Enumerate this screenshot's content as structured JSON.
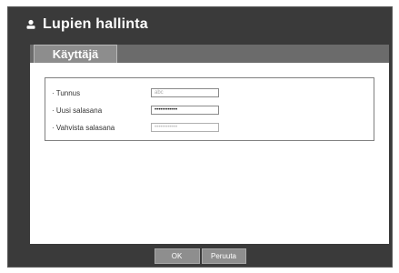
{
  "window": {
    "title": "Lupien hallinta",
    "icon": "user-icon"
  },
  "tabs": [
    {
      "label": "Käyttäjä",
      "active": true
    }
  ],
  "form": {
    "fields": [
      {
        "label": "· Tunnus",
        "value": "abc"
      },
      {
        "label": "· Uusi salasana",
        "value": "••••••••••••"
      },
      {
        "label": "· Vahvista salasana",
        "value": "••••••••••••"
      }
    ]
  },
  "buttons": {
    "ok": "OK",
    "cancel": "Peruuta"
  },
  "colors": {
    "dialog_bg": "#3a3a3a",
    "tab_bar": "#6b6b6b",
    "tab_active": "#8d8d8d",
    "button_bg": "#8e8e8e"
  }
}
